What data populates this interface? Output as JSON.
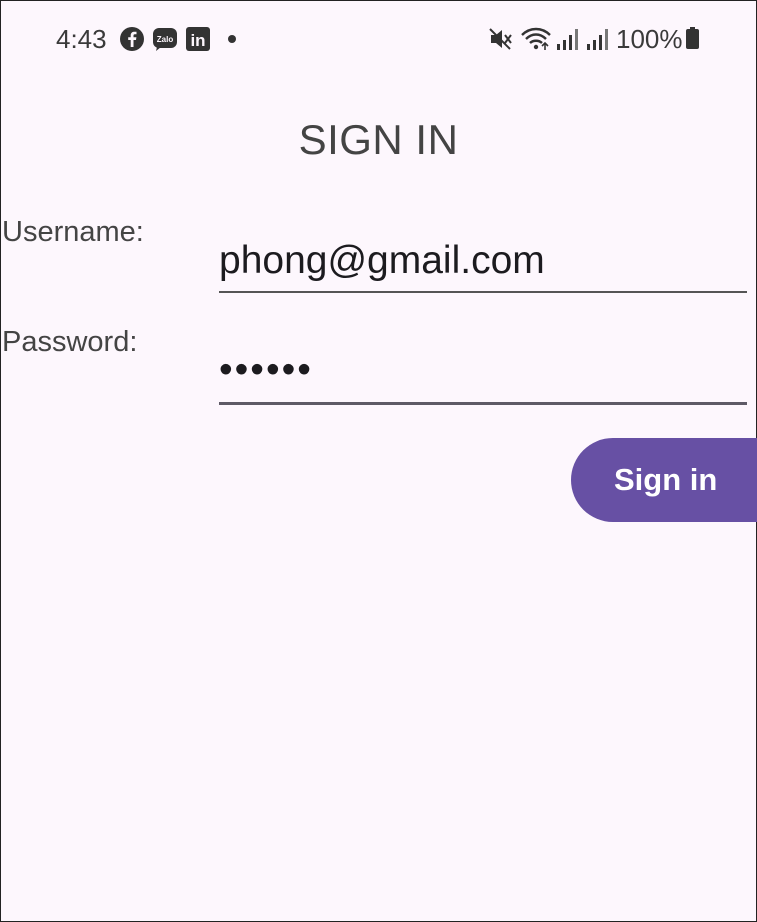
{
  "status_bar": {
    "time": "4:43",
    "battery": "100%",
    "icons": [
      "facebook-icon",
      "zalo-icon",
      "linkedin-icon",
      "notification-dot-icon",
      "mute-icon",
      "wifi-icon",
      "signal-icon",
      "signal-icon",
      "battery-icon"
    ],
    "zalo_text": "Zalo",
    "linkedin_text": "in"
  },
  "page": {
    "title": "SIGN IN"
  },
  "form": {
    "username_label": "Username:",
    "username_value": "phong@gmail.com",
    "password_label": "Password:",
    "password_value": "••••••",
    "signin_label": "Sign in"
  },
  "colors": {
    "accent": "#6750a4",
    "background": "#fdf7fd"
  }
}
